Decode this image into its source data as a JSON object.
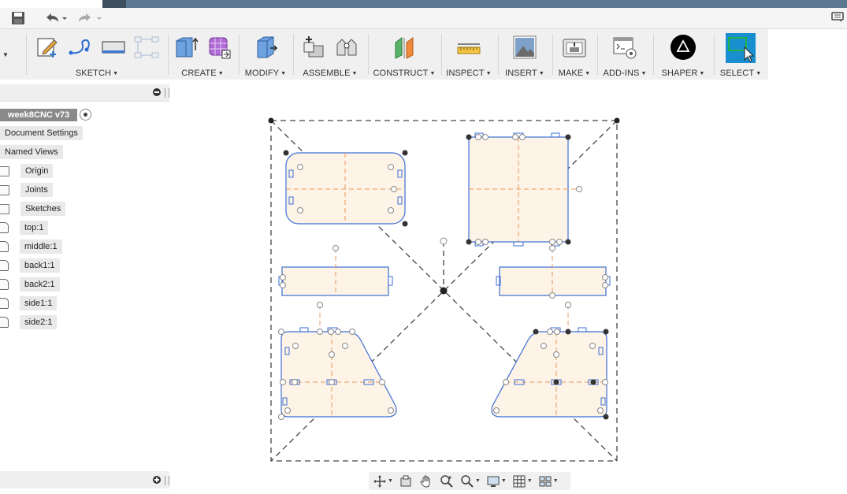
{
  "ribbon": {
    "groups": [
      {
        "id": "sketch",
        "label": "SKETCH"
      },
      {
        "id": "create",
        "label": "CREATE"
      },
      {
        "id": "modify",
        "label": "MODIFY"
      },
      {
        "id": "assemble",
        "label": "ASSEMBLE"
      },
      {
        "id": "construct",
        "label": "CONSTRUCT"
      },
      {
        "id": "inspect",
        "label": "INSPECT"
      },
      {
        "id": "insert",
        "label": "INSERT"
      },
      {
        "id": "make",
        "label": "MAKE"
      },
      {
        "id": "addins",
        "label": "ADD-INS"
      },
      {
        "id": "shaper",
        "label": "SHAPER"
      },
      {
        "id": "select",
        "label": "SELECT"
      }
    ]
  },
  "browser": {
    "document_name": "week8CNC v73",
    "items": [
      {
        "label": "Document Settings",
        "icon": "none"
      },
      {
        "label": "Named Views",
        "icon": "none"
      },
      {
        "label": "Origin",
        "icon": "folder-icon"
      },
      {
        "label": "Joints",
        "icon": "folder-icon"
      },
      {
        "label": "Sketches",
        "icon": "folder-icon"
      },
      {
        "label": "top:1",
        "icon": "body-icon"
      },
      {
        "label": "middle:1",
        "icon": "body-icon"
      },
      {
        "label": "back1:1",
        "icon": "body-icon"
      },
      {
        "label": "back2:1",
        "icon": "body-icon"
      },
      {
        "label": "side1:1",
        "icon": "body-icon"
      },
      {
        "label": "side2:1",
        "icon": "body-icon"
      }
    ]
  },
  "colors": {
    "profile_fill": "#fdf3e7",
    "profile_stroke": "#3d6fd6",
    "construction_line": "#e59a5c",
    "select_accent": "#1a8fd0"
  }
}
